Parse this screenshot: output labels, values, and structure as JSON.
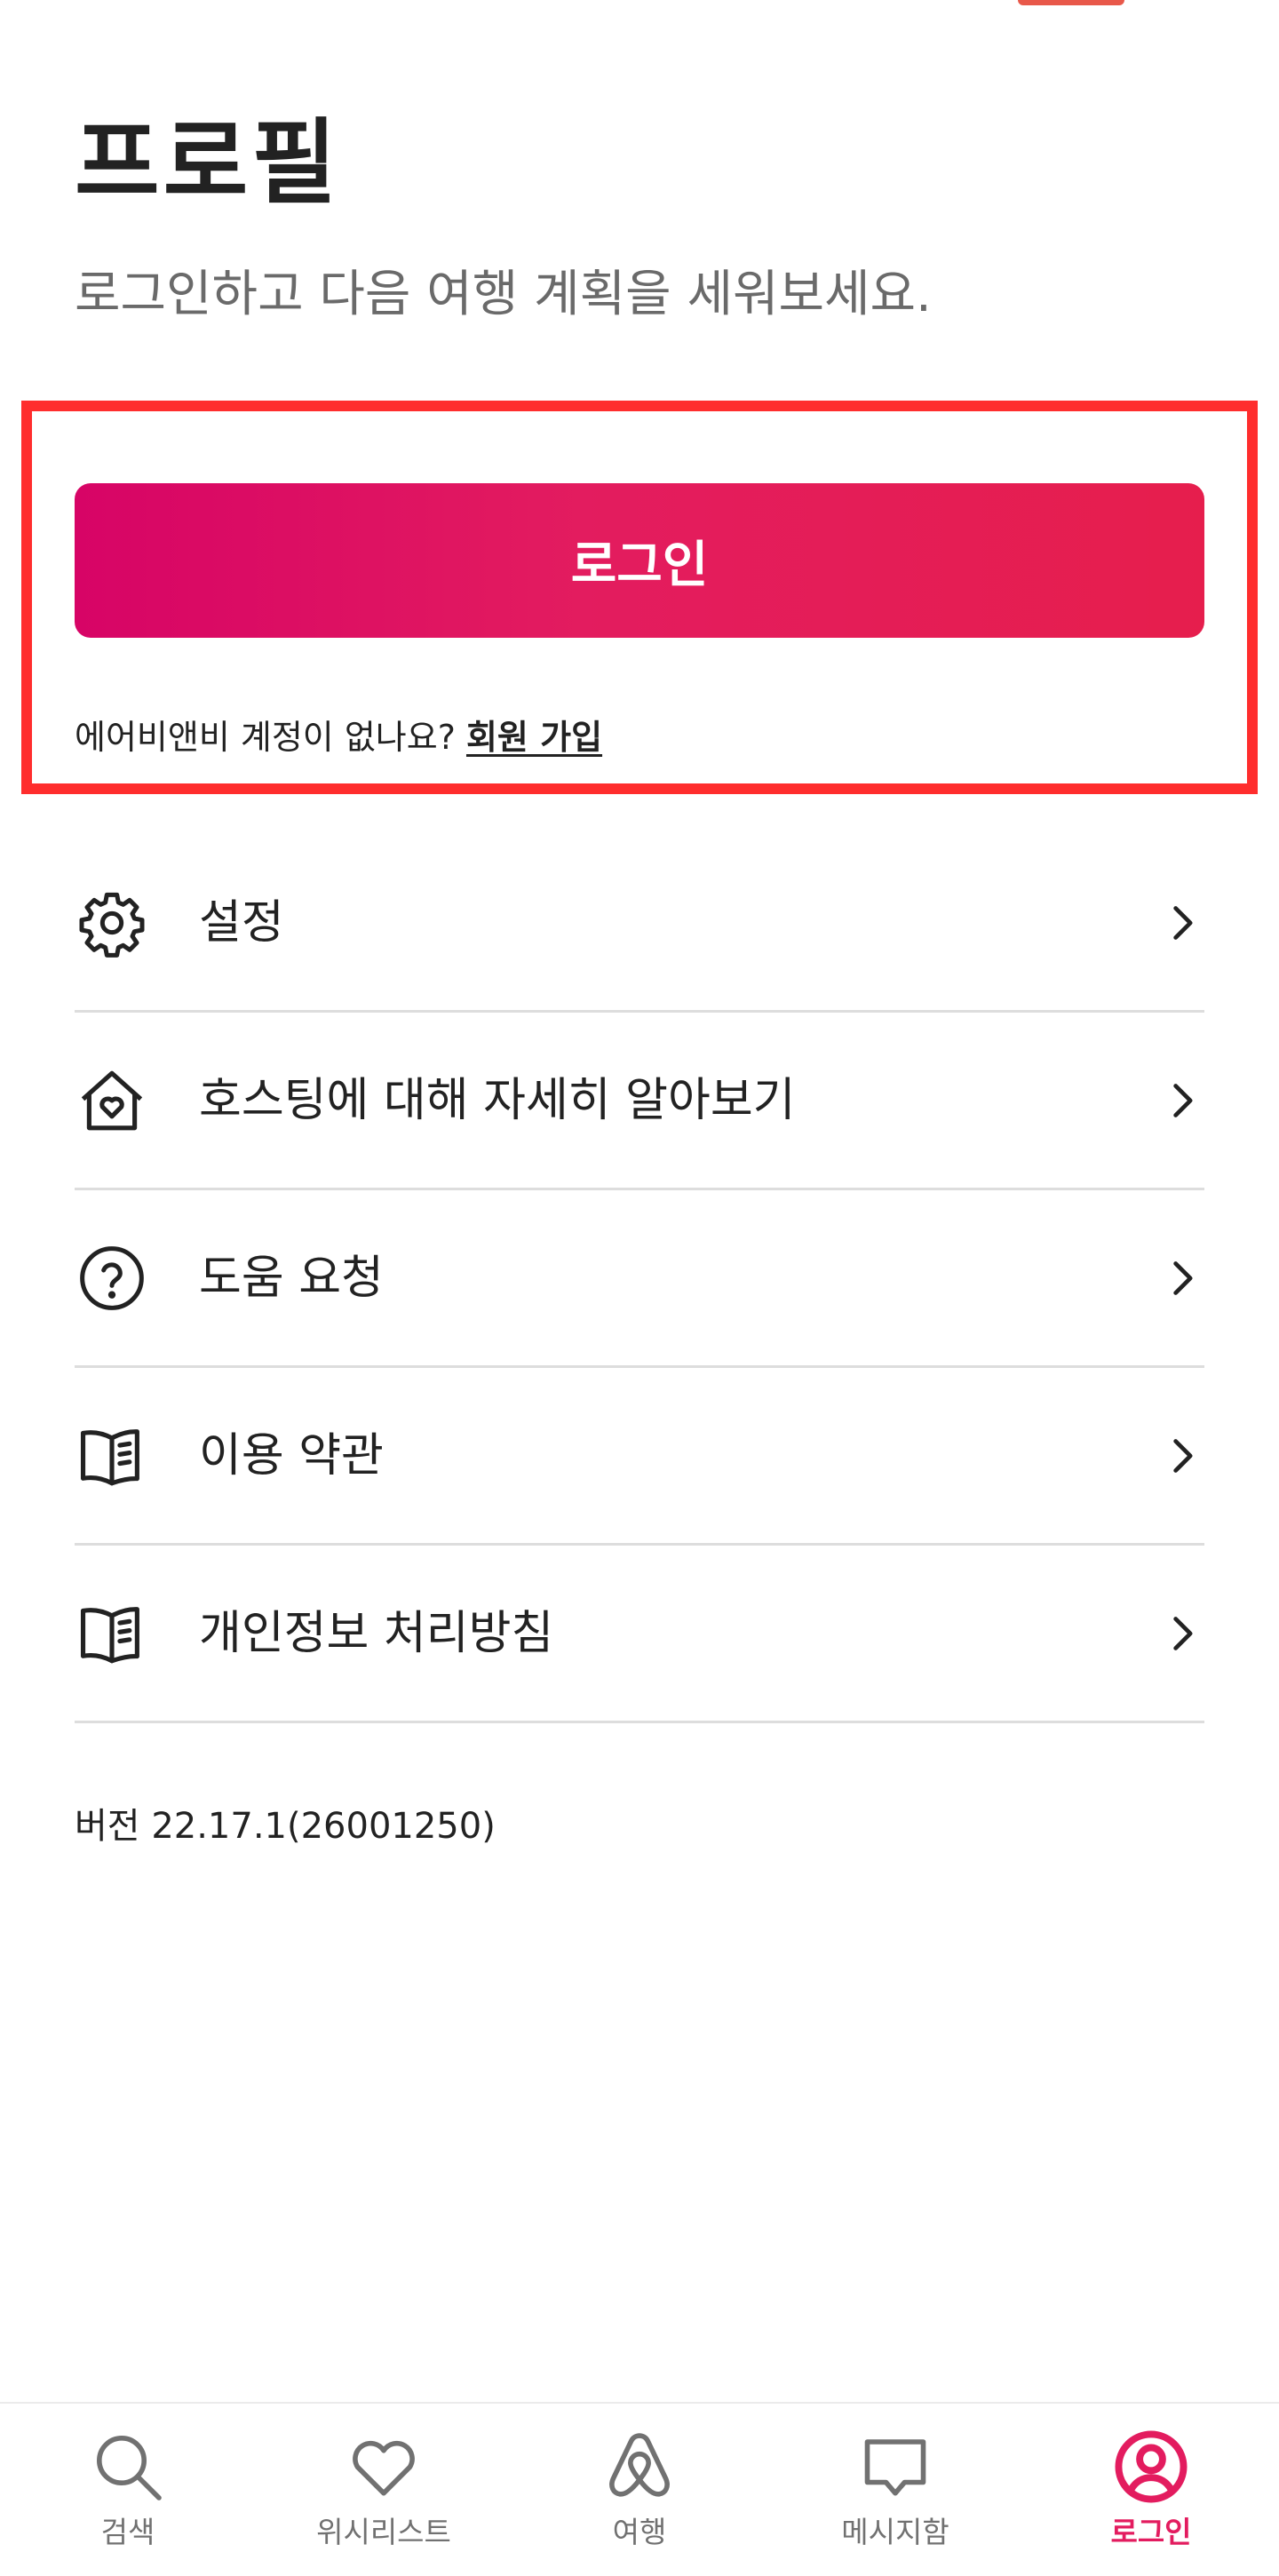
{
  "header": {
    "title": "프로필",
    "subtitle": "로그인하고 다음 여행 계획을 세워보세요."
  },
  "login": {
    "button_label": "로그인",
    "signup_prompt": "에어비앤비 계정이 없나요? ",
    "signup_link": "회원 가입"
  },
  "menu": {
    "items": [
      {
        "label": "설정",
        "icon": "gear-icon"
      },
      {
        "label": "호스팅에 대해 자세히 알아보기",
        "icon": "home-heart-icon"
      },
      {
        "label": "도움 요청",
        "icon": "question-circle-icon"
      },
      {
        "label": "이용 약관",
        "icon": "book-icon"
      },
      {
        "label": "개인정보 처리방침",
        "icon": "book-icon"
      }
    ]
  },
  "footer": {
    "version": "버전 22.17.1(26001250)"
  },
  "bottom_nav": {
    "items": [
      {
        "label": "검색",
        "icon": "search-icon",
        "active": false
      },
      {
        "label": "위시리스트",
        "icon": "heart-icon",
        "active": false
      },
      {
        "label": "여행",
        "icon": "airbnb-logo-icon",
        "active": false
      },
      {
        "label": "메시지함",
        "icon": "message-icon",
        "active": false
      },
      {
        "label": "로그인",
        "icon": "user-circle-icon",
        "active": true
      }
    ]
  },
  "colors": {
    "accent": "#e31c5f",
    "highlight_border": "#ff2d2d",
    "text_primary": "#222222",
    "text_secondary": "#6a6a6a",
    "nav_inactive": "#717171",
    "divider": "#dddddd"
  }
}
